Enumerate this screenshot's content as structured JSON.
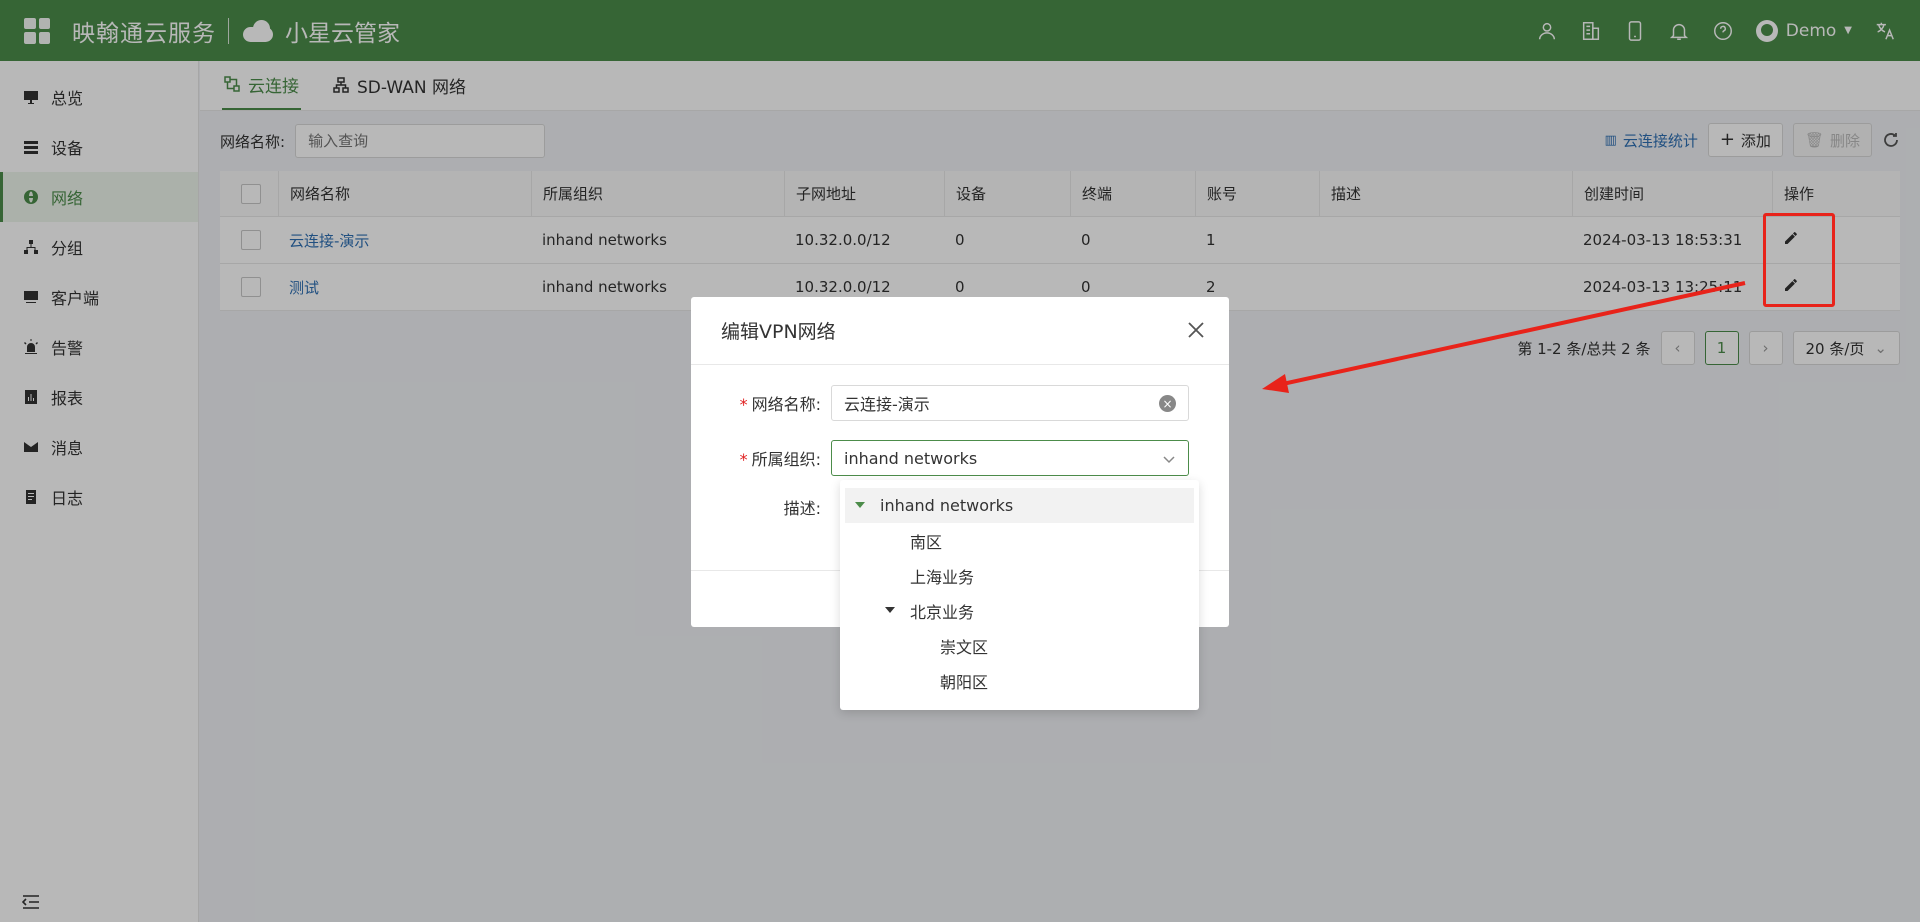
{
  "topbar": {
    "brand": "映翰通云服务",
    "brand2": "小星云管家",
    "user": "Demo",
    "icons": [
      "user-icon",
      "building-icon",
      "phone-icon",
      "bell-icon",
      "help-icon",
      "avatar",
      "translate-icon"
    ]
  },
  "sidebar": {
    "items": [
      {
        "label": "总览",
        "icon": "monitor-icon"
      },
      {
        "label": "设备",
        "icon": "server-icon"
      },
      {
        "label": "网络",
        "icon": "globe-icon",
        "active": true
      },
      {
        "label": "分组",
        "icon": "hierarchy-icon"
      },
      {
        "label": "客户端",
        "icon": "client-icon"
      },
      {
        "label": "告警",
        "icon": "alarm-icon"
      },
      {
        "label": "报表",
        "icon": "report-icon"
      },
      {
        "label": "消息",
        "icon": "mail-icon"
      },
      {
        "label": "日志",
        "icon": "log-icon"
      }
    ]
  },
  "tabs": [
    {
      "label": "云连接",
      "active": true
    },
    {
      "label": "SD-WAN 网络"
    }
  ],
  "filter": {
    "label": "网络名称:",
    "placeholder": "输入查询"
  },
  "actions": {
    "stats": "云连接统计",
    "add": "添加",
    "delete": "删除"
  },
  "table": {
    "columns": [
      "网络名称",
      "所属组织",
      "子网地址",
      "设备",
      "终端",
      "账号",
      "描述",
      "创建时间",
      "操作"
    ],
    "rows": [
      {
        "name": "云连接-演示",
        "org": "inhand networks",
        "subnet": "10.32.0.0/12",
        "devices": "0",
        "terminals": "0",
        "accounts": "1",
        "desc": "",
        "created": "2024-03-13 18:53:31"
      },
      {
        "name": "测试",
        "org": "inhand networks",
        "subnet": "10.32.0.0/12",
        "devices": "0",
        "terminals": "0",
        "accounts": "2",
        "desc": "",
        "created": "2024-03-13 13:25:11"
      }
    ]
  },
  "pager": {
    "summary": "第 1-2 条/总共 2 条",
    "current": "1",
    "size": "20 条/页"
  },
  "modal": {
    "title": "编辑VPN网络",
    "name_label": "网络名称:",
    "name_value": "云连接-演示",
    "org_label": "所属组织:",
    "org_value": "inhand networks",
    "desc_label": "描述:"
  },
  "dropdown": {
    "items": [
      {
        "label": "inhand networks",
        "level": 0,
        "expanded": true
      },
      {
        "label": "南区",
        "level": 1
      },
      {
        "label": "上海业务",
        "level": 1
      },
      {
        "label": "北京业务",
        "level": 1,
        "expanded": true
      },
      {
        "label": "崇文区",
        "level": 2
      },
      {
        "label": "朝阳区",
        "level": 2
      }
    ]
  },
  "colors": {
    "brand": "#4c8c4a",
    "link": "#2f6fb3",
    "annotation": "#e8231a"
  }
}
